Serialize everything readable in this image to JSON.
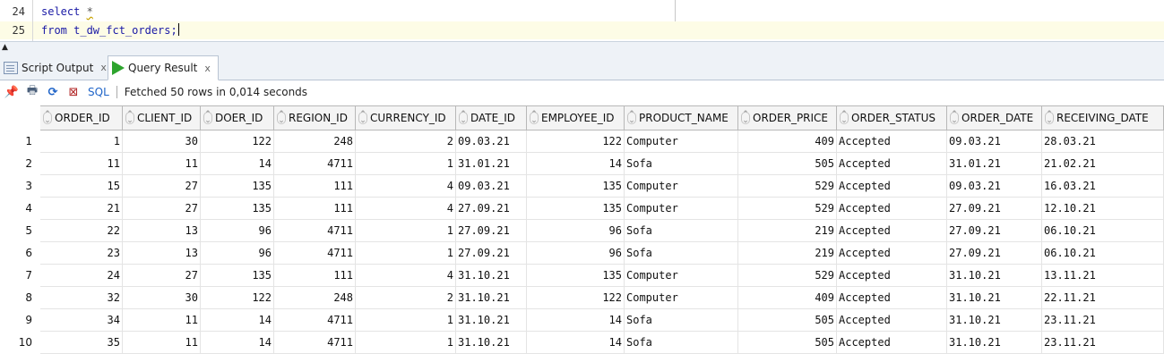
{
  "editor": {
    "lines": [
      {
        "number": "24",
        "code": "select ",
        "code_star": "*"
      },
      {
        "number": "25",
        "code": "from t_dw_fct_orders;"
      }
    ]
  },
  "tabs": [
    {
      "label": "Script Output",
      "close": "x",
      "icon": "script-output-icon"
    },
    {
      "label": "Query Result",
      "close": "x",
      "icon": "run-icon"
    }
  ],
  "toolbar": {
    "sql_label": "SQL",
    "status": "Fetched 50 rows in 0,014 seconds"
  },
  "grid": {
    "columns": [
      "ORDER_ID",
      "CLIENT_ID",
      "DOER_ID",
      "REGION_ID",
      "CURRENCY_ID",
      "DATE_ID",
      "EMPLOYEE_ID",
      "PRODUCT_NAME",
      "ORDER_PRICE",
      "ORDER_STATUS",
      "ORDER_DATE",
      "RECEIVING_DATE"
    ],
    "rows": [
      {
        "n": "1",
        "cells": [
          "1",
          "30",
          "122",
          "248",
          "2",
          "09.03.21",
          "122",
          "Computer",
          "409",
          "Accepted",
          "09.03.21",
          "28.03.21"
        ]
      },
      {
        "n": "2",
        "cells": [
          "11",
          "11",
          "14",
          "4711",
          "1",
          "31.01.21",
          "14",
          "Sofa",
          "505",
          "Accepted",
          "31.01.21",
          "21.02.21"
        ]
      },
      {
        "n": "3",
        "cells": [
          "15",
          "27",
          "135",
          "111",
          "4",
          "09.03.21",
          "135",
          "Computer",
          "529",
          "Accepted",
          "09.03.21",
          "16.03.21"
        ]
      },
      {
        "n": "4",
        "cells": [
          "21",
          "27",
          "135",
          "111",
          "4",
          "27.09.21",
          "135",
          "Computer",
          "529",
          "Accepted",
          "27.09.21",
          "12.10.21"
        ]
      },
      {
        "n": "5",
        "cells": [
          "22",
          "13",
          "96",
          "4711",
          "1",
          "27.09.21",
          "96",
          "Sofa",
          "219",
          "Accepted",
          "27.09.21",
          "06.10.21"
        ]
      },
      {
        "n": "6",
        "cells": [
          "23",
          "13",
          "96",
          "4711",
          "1",
          "27.09.21",
          "96",
          "Sofa",
          "219",
          "Accepted",
          "27.09.21",
          "06.10.21"
        ]
      },
      {
        "n": "7",
        "cells": [
          "24",
          "27",
          "135",
          "111",
          "4",
          "31.10.21",
          "135",
          "Computer",
          "529",
          "Accepted",
          "31.10.21",
          "13.11.21"
        ]
      },
      {
        "n": "8",
        "cells": [
          "32",
          "30",
          "122",
          "248",
          "2",
          "31.10.21",
          "122",
          "Computer",
          "409",
          "Accepted",
          "31.10.21",
          "22.11.21"
        ]
      },
      {
        "n": "9",
        "cells": [
          "34",
          "11",
          "14",
          "4711",
          "1",
          "31.10.21",
          "14",
          "Sofa",
          "505",
          "Accepted",
          "31.10.21",
          "23.11.21"
        ]
      },
      {
        "n": "10",
        "cells": [
          "35",
          "11",
          "14",
          "4711",
          "1",
          "31.10.21",
          "14",
          "Sofa",
          "505",
          "Accepted",
          "31.10.21",
          "23.11.21"
        ]
      }
    ]
  }
}
